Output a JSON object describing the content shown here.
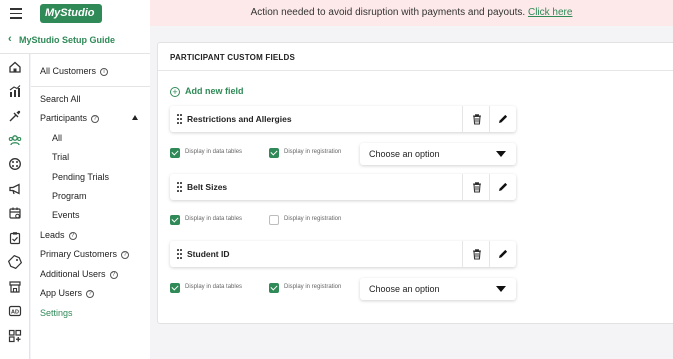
{
  "header": {
    "logo_text": "MyStudio",
    "banner_text": "Action needed to avoid disruption with payments and payouts.",
    "banner_link": "Click here"
  },
  "setup_guide": {
    "label": "MyStudio Setup Guide"
  },
  "rail_icons": [
    "home-icon",
    "chart-icon",
    "tag-icon",
    "users-icon",
    "palette-icon",
    "megaphone-icon",
    "calendar-icon",
    "clipboard-icon",
    "coupon-icon",
    "store-icon",
    "ad-icon",
    "apps-icon"
  ],
  "sidebar": {
    "all_customers": "All Customers",
    "search_all": "Search All",
    "participants": "Participants",
    "participants_sub": [
      "All",
      "Trial",
      "Pending Trials",
      "Program",
      "Events"
    ],
    "leads": "Leads",
    "primary_customers": "Primary Customers",
    "additional_users": "Additional Users",
    "app_users": "App Users",
    "settings": "Settings"
  },
  "panel": {
    "title": "PARTICIPANT CUSTOM FIELDS",
    "add_label": "Add new field",
    "fields": [
      {
        "name": "Restrictions and Allergies",
        "display_tables_label": "Display in data tables",
        "display_tables": true,
        "display_registration_label": "Display in registration",
        "display_registration": true,
        "select_value": "Choose an option",
        "has_select": true
      },
      {
        "name": "Belt Sizes",
        "display_tables_label": "Display in data tables",
        "display_tables": true,
        "display_registration_label": "Display in registration",
        "display_registration": false,
        "select_value": "",
        "has_select": false
      },
      {
        "name": "Student ID",
        "display_tables_label": "Display in data tables",
        "display_tables": true,
        "display_registration_label": "Display in registration",
        "display_registration": true,
        "select_value": "Choose an option",
        "has_select": true
      }
    ]
  },
  "colors": {
    "accent": "#2f8a57",
    "banner_bg": "#fde9ea",
    "page_bg": "#f4f4f6"
  }
}
